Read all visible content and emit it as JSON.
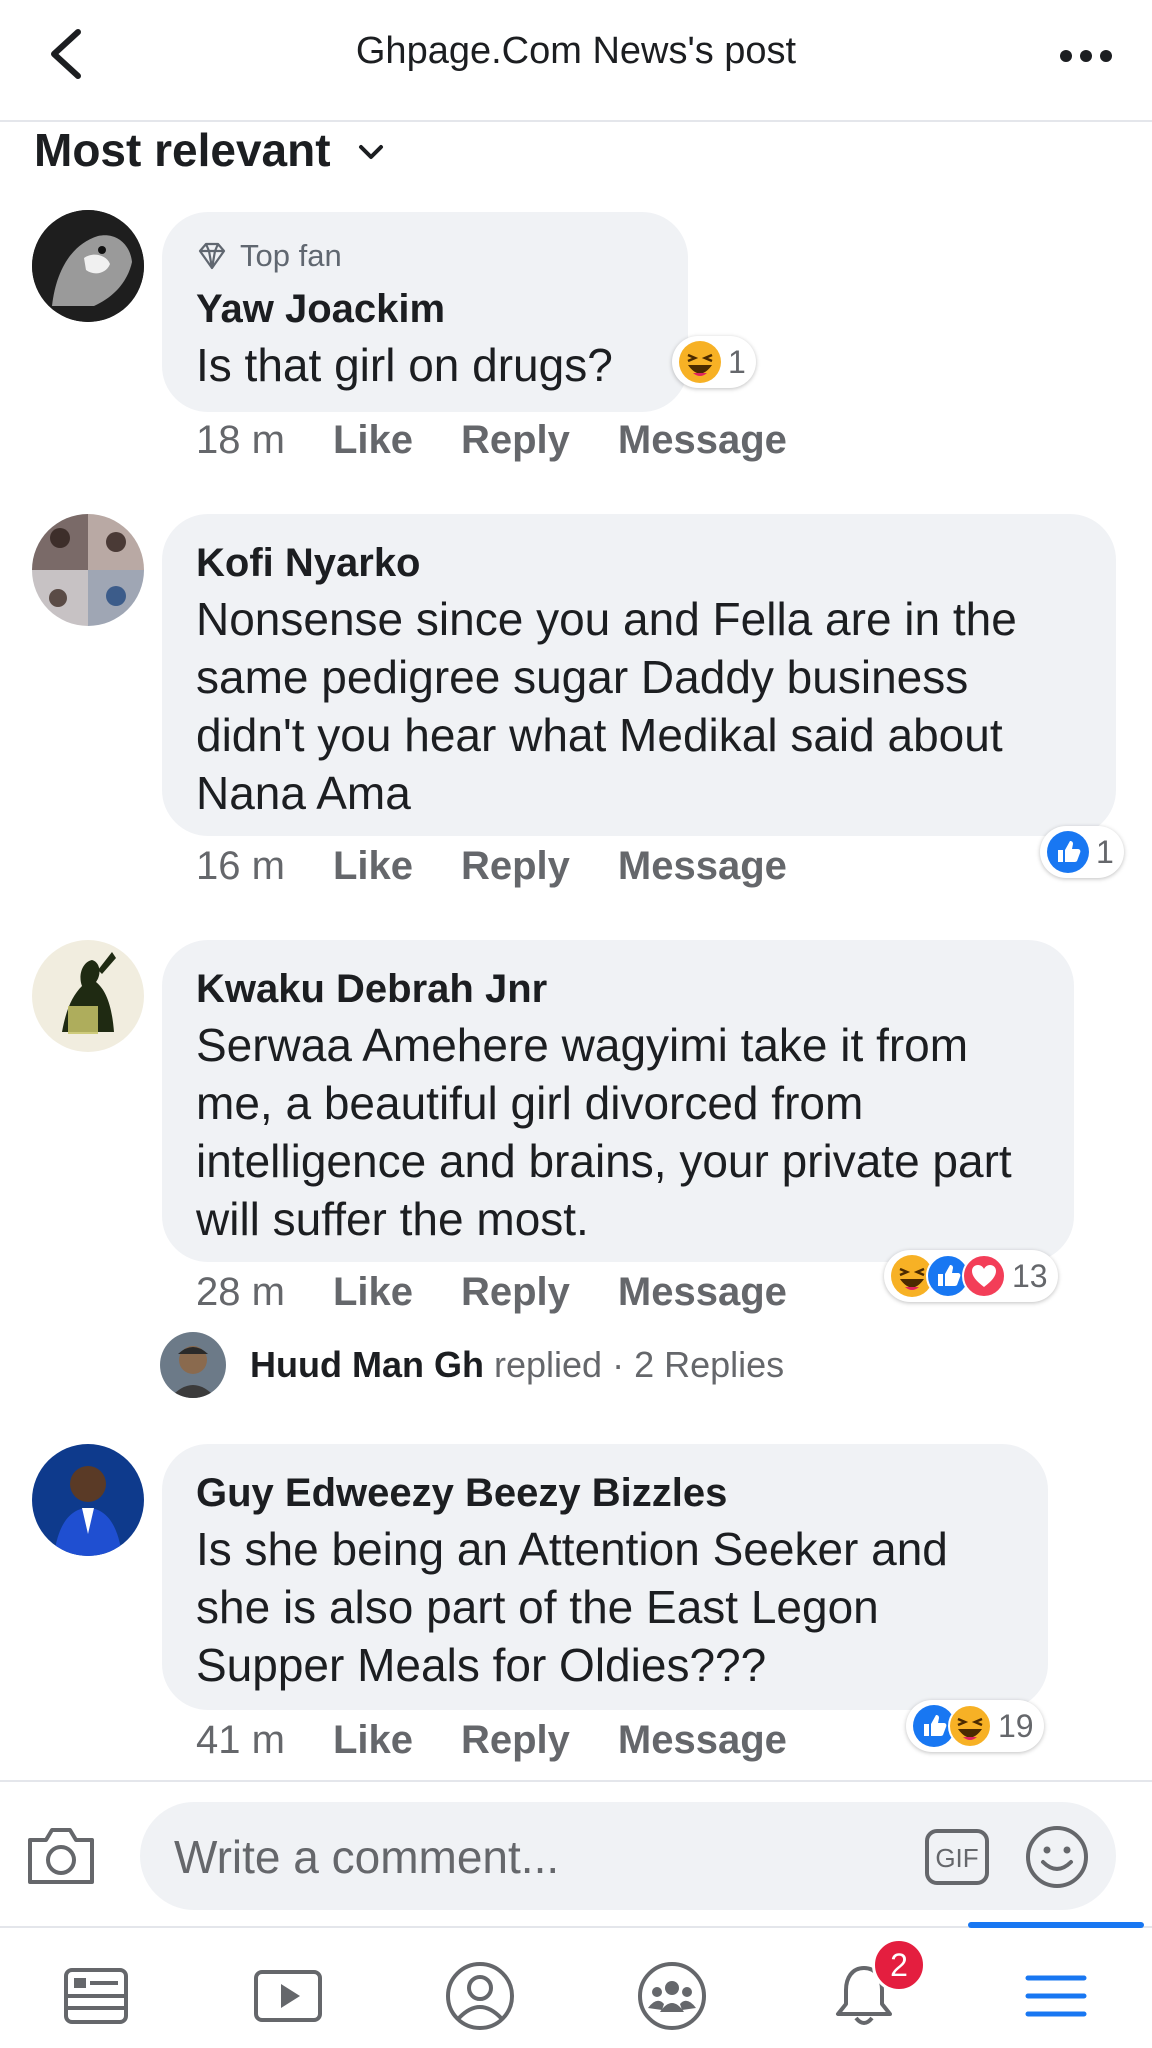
{
  "header": {
    "title": "Ghpage.Com News's post",
    "back_icon": "chevron-left-icon",
    "more_icon": "more-horizontal-icon"
  },
  "sort": {
    "label": "Most relevant",
    "icon": "chevron-down-icon"
  },
  "comments": [
    {
      "badge": "Top fan",
      "author": "Yaw Joackim",
      "text": "Is that girl on drugs?",
      "time": "18 m",
      "like": "Like",
      "reply": "Reply",
      "message": "Message",
      "reactions": [
        "haha"
      ],
      "reaction_count": "1"
    },
    {
      "author": "Kofi Nyarko",
      "text": "Nonsense since you and Fella are in the same pedigree sugar Daddy business didn't you hear what Medikal said about Nana Ama",
      "time": "16 m",
      "like": "Like",
      "reply": "Reply",
      "message": "Message",
      "reactions": [
        "like"
      ],
      "reaction_count": "1"
    },
    {
      "author": "Kwaku Debrah Jnr",
      "text": "Serwaa Amehere wagyimi take it from me, a beautiful girl divorced from intelligence and brains, your private part will suffer the most.",
      "time": "28 m",
      "like": "Like",
      "reply": "Reply",
      "message": "Message",
      "reactions": [
        "haha",
        "like",
        "love"
      ],
      "reaction_count": "13",
      "replies": {
        "name": "Huud Man Gh",
        "verb": "replied",
        "sep": " · ",
        "count": "2 Replies"
      }
    },
    {
      "author": "Guy Edweezy Beezy Bizzles",
      "text": "Is she being an Attention Seeker and she is also part of the East Legon Supper Meals for Oldies???",
      "time": "41 m",
      "like": "Like",
      "reply": "Reply",
      "message": "Message",
      "reactions": [
        "like",
        "haha"
      ],
      "reaction_count": "19"
    }
  ],
  "composer": {
    "placeholder": "Write a comment...",
    "gif_label": "GIF",
    "camera_icon": "camera-icon",
    "emoji_icon": "smiley-icon"
  },
  "bottom_nav": {
    "items": [
      "news-feed-icon",
      "watch-icon",
      "profile-icon",
      "groups-icon",
      "notifications-icon",
      "menu-icon"
    ],
    "notification_badge": "2",
    "active": "menu-icon"
  },
  "colors": {
    "accent": "#1877f2",
    "bubble": "#f0f2f5",
    "badge": "#e41e3f",
    "secondary_text": "#65676b"
  }
}
